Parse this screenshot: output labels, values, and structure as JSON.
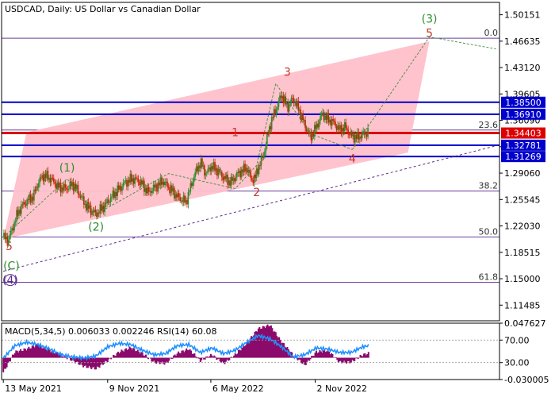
{
  "chart_data": {
    "type": "line",
    "header": {
      "symbol_title": "USDCAD, Daily:  US Dollar vs Canadian Dollar"
    },
    "price_axis": {
      "ylim": [
        1.094,
        1.518
      ],
      "tick_labels": [
        "1.50151",
        "1.46635",
        "1.43120",
        "1.39605",
        "1.36090",
        "1.32575",
        "1.29060",
        "1.25545",
        "1.22030",
        "1.18515",
        "1.15000",
        "1.11485"
      ],
      "tick_values": [
        1.50151,
        1.46635,
        1.4312,
        1.39605,
        1.3609,
        1.32575,
        1.2906,
        1.25545,
        1.2203,
        1.18515,
        1.15,
        1.11485
      ]
    },
    "time_axis": {
      "labels": [
        "13 May 2021",
        "9 Nov 2021",
        "6 May 2022",
        "2 Nov 2022"
      ],
      "label_x_days": [
        0,
        180,
        358,
        538
      ],
      "xlim_days": [
        -3,
        856
      ]
    },
    "levels": [
      {
        "label": "1.38500",
        "value": 1.385,
        "color": "#0000cc",
        "tag_bg": "#0000cc"
      },
      {
        "label": "1.36910",
        "value": 1.3691,
        "color": "#0000cc",
        "tag_bg": "#0000cc"
      },
      {
        "label": "1.34403",
        "value": 1.34403,
        "color": "#dd0000",
        "tag_bg": "#dd0000"
      },
      {
        "label": "1.32781",
        "value": 1.32781,
        "color": "#0000cc",
        "tag_bg": "#0000cc"
      },
      {
        "label": "1.31269",
        "value": 1.31269,
        "color": "#0000cc",
        "tag_bg": "#0000cc"
      }
    ],
    "fib_levels": [
      {
        "label": "0.0",
        "value": 1.4703
      },
      {
        "label": "23.6",
        "value": 1.348
      },
      {
        "label": "38.2",
        "value": 1.2668
      },
      {
        "label": "50.0",
        "value": 1.2055
      },
      {
        "label": "61.8",
        "value": 1.1453
      }
    ],
    "channel": {
      "color": "#ffc0cb",
      "points": [
        [
          0,
          1.203
        ],
        [
          40,
          1.345
        ],
        [
          735,
          1.466
        ],
        [
          698,
          1.318
        ]
      ]
    },
    "price_series": {
      "name": "",
      "up_color": "#2e8b2e",
      "down_color": "#cc2200",
      "x": [
        0,
        8,
        15,
        22,
        30,
        40,
        52,
        60,
        70,
        82,
        95,
        108,
        120,
        130,
        140,
        150,
        160,
        175,
        190,
        200,
        210,
        222,
        235,
        250,
        262,
        275,
        290,
        302,
        315,
        330,
        340,
        350,
        358,
        368,
        380,
        392,
        405,
        420,
        428,
        435,
        440,
        448,
        456,
        462,
        470,
        480,
        490,
        500,
        510,
        520,
        530,
        540,
        550,
        560,
        570,
        580,
        590,
        600,
        610,
        620,
        630
      ],
      "y": [
        1.205,
        1.201,
        1.215,
        1.232,
        1.245,
        1.253,
        1.26,
        1.278,
        1.288,
        1.283,
        1.272,
        1.27,
        1.276,
        1.265,
        1.25,
        1.242,
        1.236,
        1.248,
        1.262,
        1.27,
        1.278,
        1.283,
        1.28,
        1.265,
        1.272,
        1.28,
        1.268,
        1.258,
        1.252,
        1.289,
        1.305,
        1.289,
        1.3,
        1.295,
        1.285,
        1.278,
        1.29,
        1.298,
        1.282,
        1.285,
        1.299,
        1.312,
        1.34,
        1.36,
        1.375,
        1.395,
        1.378,
        1.39,
        1.375,
        1.355,
        1.338,
        1.352,
        1.37,
        1.362,
        1.358,
        1.348,
        1.352,
        1.34,
        1.338,
        1.342,
        1.346
      ]
    },
    "wave_path": {
      "x": [
        0,
        110,
        160,
        285,
        400,
        437,
        470,
        530,
        602
      ],
      "y": [
        1.205,
        1.283,
        1.236,
        1.29,
        1.27,
        1.301,
        1.41,
        1.343,
        1.322
      ]
    },
    "projection": {
      "x": [
        602,
        735,
        850
      ],
      "y": [
        1.322,
        1.472,
        1.456
      ]
    },
    "trendline": {
      "x": [
        0,
        850
      ],
      "y": [
        1.16,
        1.327
      ]
    },
    "wave_labels": [
      {
        "text": "(1)",
        "x": 110,
        "y": 1.293,
        "color": "#2e8b2e"
      },
      {
        "text": "(2)",
        "x": 160,
        "y": 1.214,
        "color": "#2e8b2e"
      },
      {
        "text": "1",
        "x": 400,
        "y": 1.34,
        "color": "#c0392b"
      },
      {
        "text": "2",
        "x": 437,
        "y": 1.26,
        "color": "#c0392b"
      },
      {
        "text": "3",
        "x": 490,
        "y": 1.42,
        "color": "#c0392b"
      },
      {
        "text": "4",
        "x": 602,
        "y": 1.305,
        "color": "#c0392b"
      },
      {
        "text": "5",
        "x": 735,
        "y": 1.472,
        "color": "#c0392b"
      },
      {
        "text": "(3)",
        "x": 735,
        "y": 1.491,
        "color": "#2e8b2e"
      },
      {
        "text": "5",
        "x": 10,
        "y": 1.188,
        "color": "#c0392b"
      },
      {
        "text": "(C)",
        "x": 14,
        "y": 1.162,
        "color": "#2e8b2e"
      },
      {
        "text": "(4)",
        "x": 12,
        "y": 1.143,
        "color": "#5a2d8c"
      }
    ],
    "indicator": {
      "label": "MACD(5,34,5) 0.006033 0.002246 RSI(14) 60.08",
      "tick_labels": [
        "0.047627",
        "70.00",
        "30.00",
        "-0.030005"
      ],
      "tick_values": [
        0.047627,
        70.0,
        30.0,
        -0.030005
      ],
      "macd_color": "#8b0a6b",
      "rsi_color": "#1e90ff",
      "macd_x": [
        0,
        20,
        40,
        60,
        80,
        100,
        120,
        140,
        160,
        180,
        200,
        220,
        240,
        260,
        280,
        300,
        320,
        340,
        360,
        380,
        400,
        420,
        440,
        460,
        480,
        500,
        520,
        540,
        560,
        580,
        600,
        620,
        630
      ],
      "macd_values": [
        -0.02,
        0.008,
        0.012,
        0.018,
        0.01,
        0.004,
        -0.004,
        -0.012,
        -0.015,
        -0.004,
        0.008,
        0.014,
        0.006,
        -0.006,
        -0.008,
        0.006,
        0.012,
        -0.004,
        0.004,
        -0.008,
        0.004,
        0.02,
        0.04,
        0.045,
        0.022,
        0.004,
        -0.01,
        0.008,
        0.01,
        -0.006,
        -0.006,
        0.004,
        0.006
      ],
      "rsi_values": [
        38,
        60,
        66,
        62,
        54,
        44,
        40,
        38,
        42,
        58,
        64,
        62,
        52,
        44,
        46,
        60,
        62,
        48,
        56,
        46,
        52,
        66,
        78,
        72,
        58,
        40,
        44,
        56,
        54,
        48,
        48,
        58,
        60
      ]
    }
  }
}
